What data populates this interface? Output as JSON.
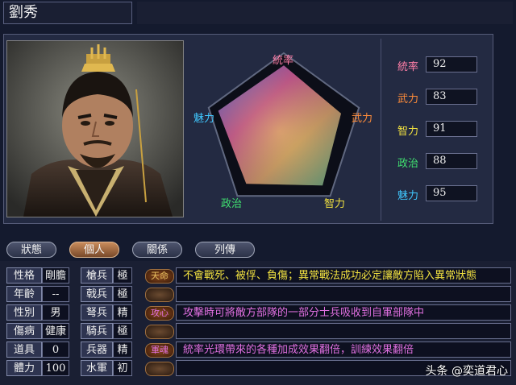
{
  "general": {
    "name": "劉秀"
  },
  "radar": {
    "labels": {
      "top": "統率",
      "right": "武力",
      "bottom_right": "智力",
      "bottom_left": "政治",
      "left": "魅力"
    },
    "values": [
      92,
      83,
      91,
      88,
      95
    ],
    "max": 100
  },
  "stats": [
    {
      "label": "統率",
      "value": "92",
      "color": "#ff7fa8"
    },
    {
      "label": "武力",
      "value": "83",
      "color": "#ff8c3a"
    },
    {
      "label": "智力",
      "value": "91",
      "color": "#f0e040"
    },
    {
      "label": "政治",
      "value": "88",
      "color": "#40e070"
    },
    {
      "label": "魅力",
      "value": "95",
      "color": "#40c8ff"
    }
  ],
  "tabs": [
    {
      "label": "狀態",
      "active": false
    },
    {
      "label": "個人",
      "active": true
    },
    {
      "label": "關係",
      "active": false
    },
    {
      "label": "列傳",
      "active": false
    }
  ],
  "personal": [
    {
      "label": "性格",
      "value": "剛膽"
    },
    {
      "label": "年齡",
      "value": "--"
    },
    {
      "label": "性別",
      "value": "男"
    },
    {
      "label": "傷病",
      "value": "健康"
    },
    {
      "label": "道具",
      "value": "0"
    },
    {
      "label": "體力",
      "value": "100"
    }
  ],
  "troops": [
    {
      "label": "槍兵",
      "value": "極"
    },
    {
      "label": "戟兵",
      "value": "極"
    },
    {
      "label": "弩兵",
      "value": "精"
    },
    {
      "label": "騎兵",
      "value": "極"
    },
    {
      "label": "兵器",
      "value": "精"
    },
    {
      "label": "水軍",
      "value": "初"
    }
  ],
  "skills": [
    {
      "badge": "天命",
      "text": "不會戰死、被俘、負傷；異常戰法成功必定讓敵方陷入異常狀態",
      "badge_color": "#e8c060",
      "text_color": "#f0e040"
    },
    {
      "badge": "",
      "text": "",
      "badge_color": "",
      "text_color": ""
    },
    {
      "badge": "攻心",
      "text": "攻擊時可將敵方部隊的一部分士兵吸收到自軍部隊中",
      "badge_color": "#e070e0",
      "text_color": "#e070e0"
    },
    {
      "badge": "",
      "text": "",
      "badge_color": "",
      "text_color": ""
    },
    {
      "badge": "軍魂",
      "text": "統率光環帶來的各種加成效果翻倍，訓練效果翻倍",
      "badge_color": "#e070e0",
      "text_color": "#e070e0"
    },
    {
      "badge": "",
      "text": "",
      "badge_color": "",
      "text_color": ""
    }
  ],
  "watermark": "头条 @奕道君心"
}
